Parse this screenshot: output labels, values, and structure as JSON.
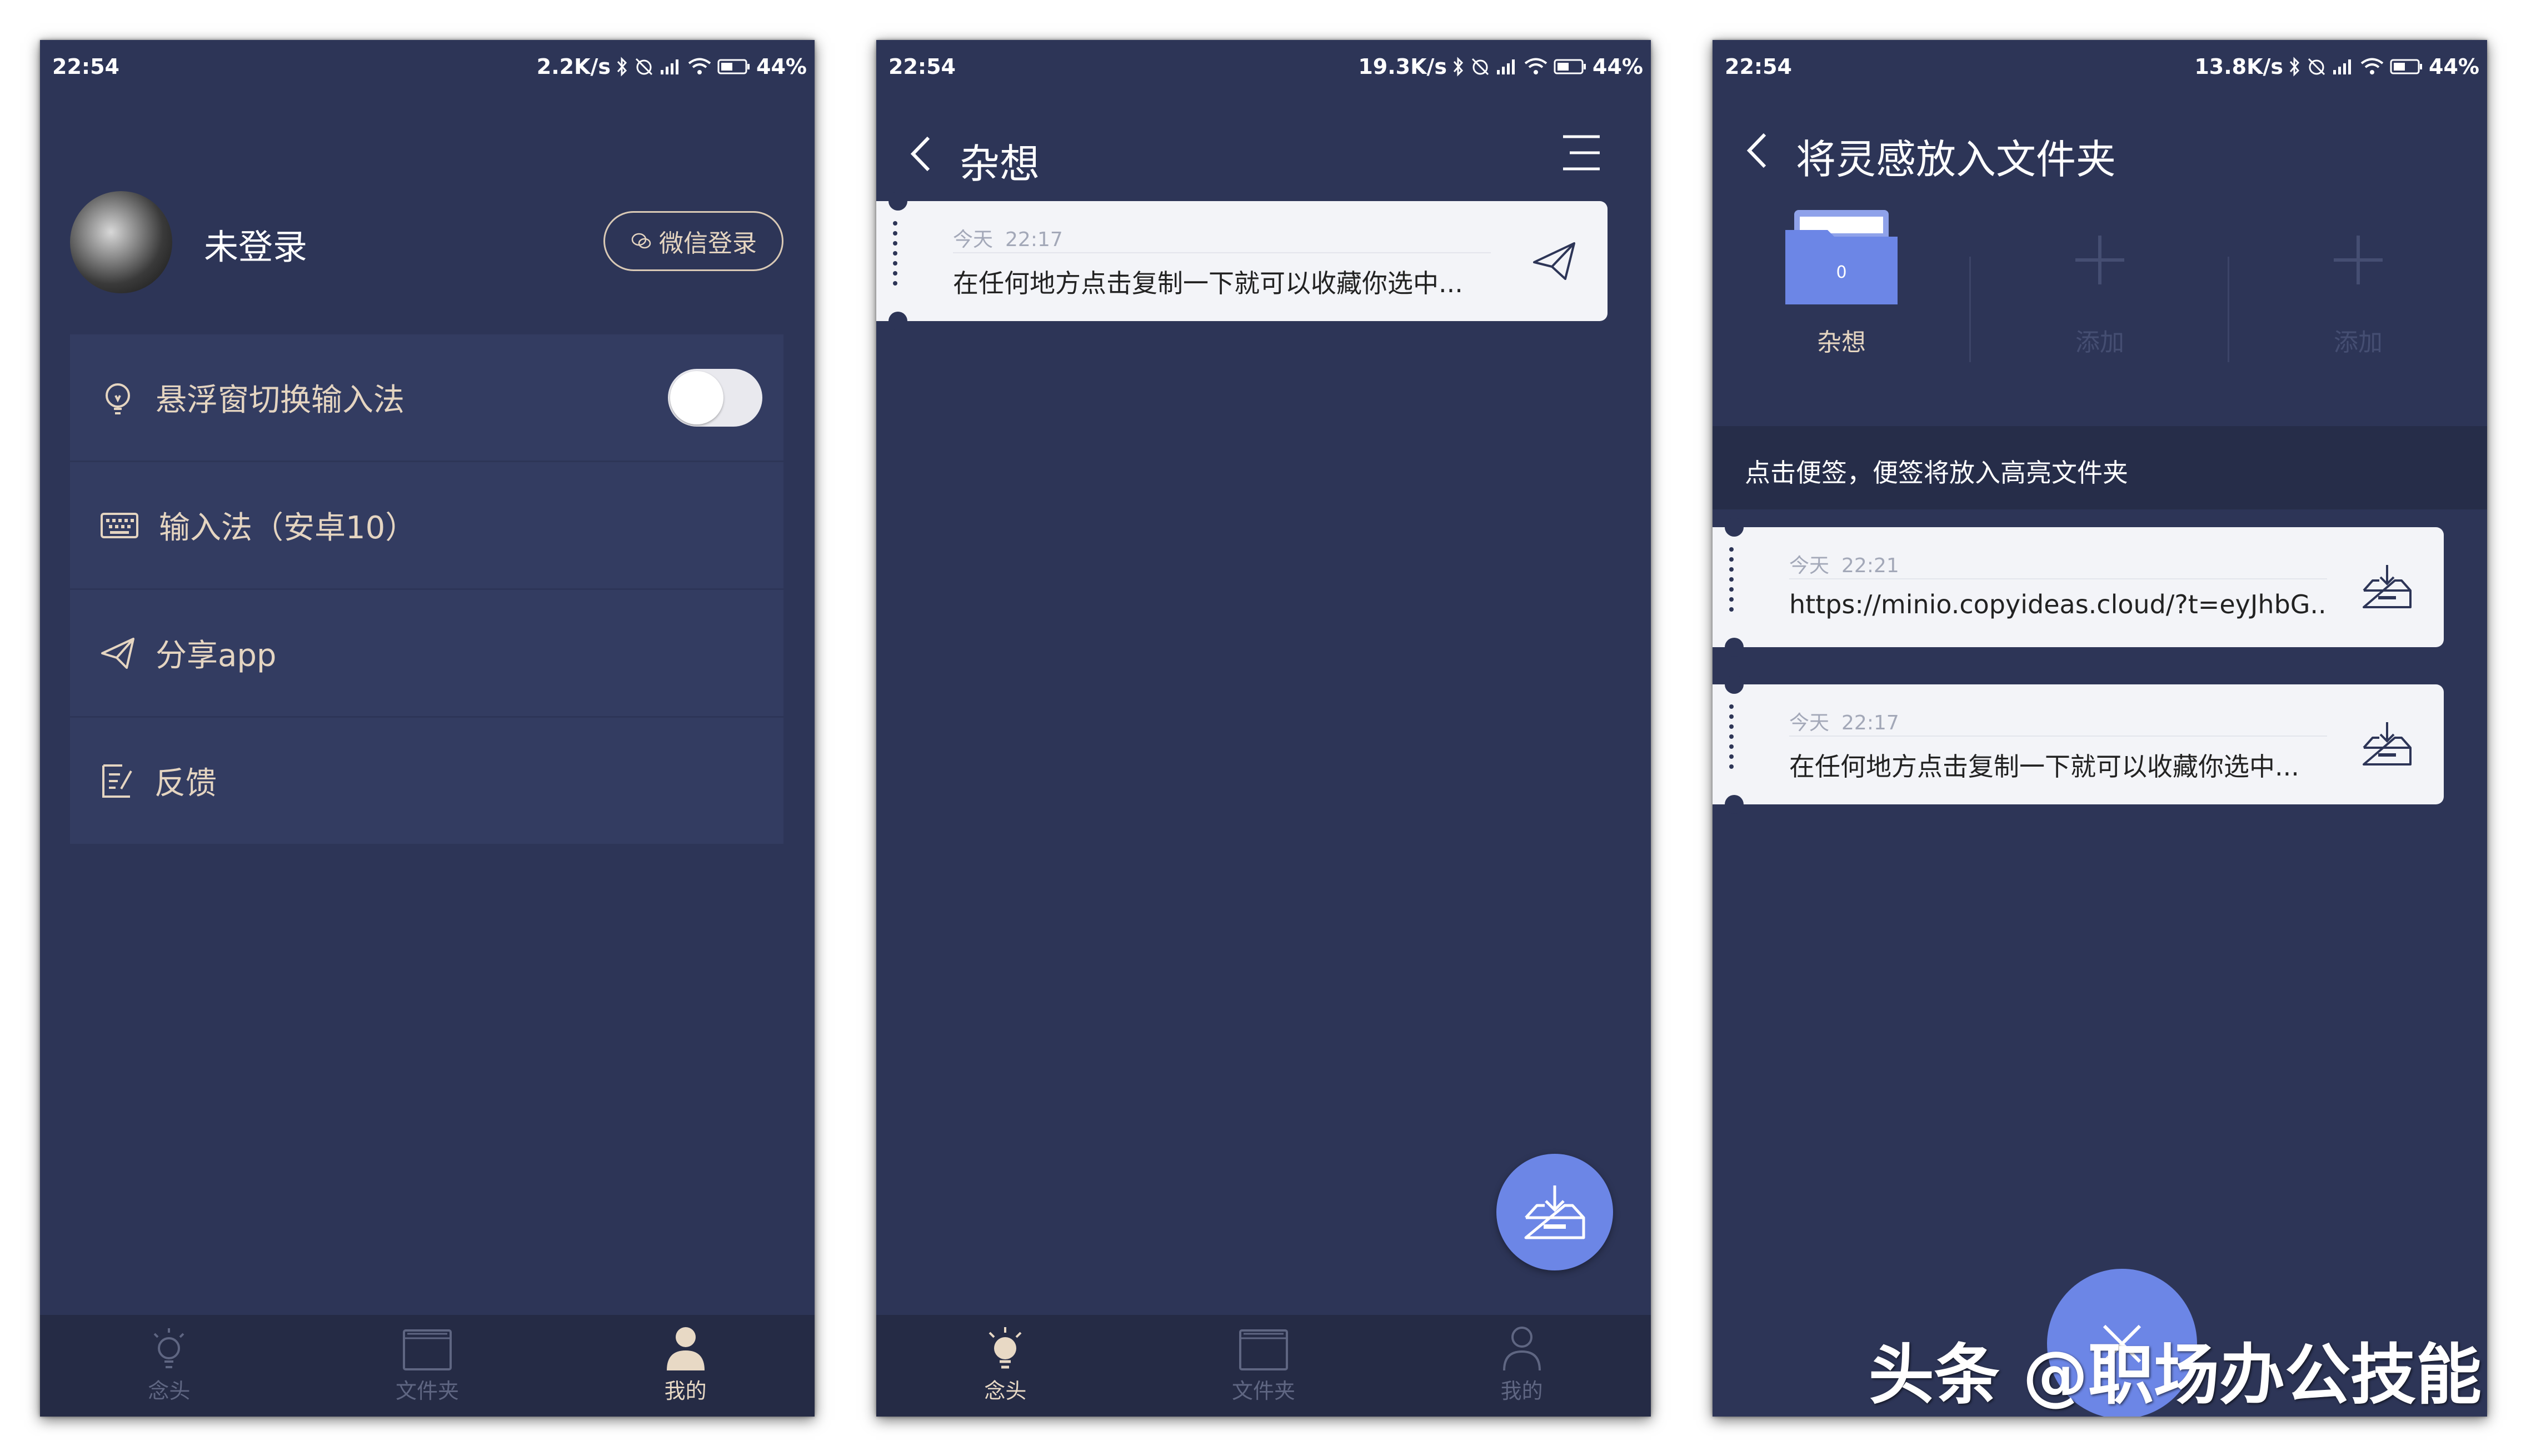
{
  "status_bars": [
    {
      "time": "22:54",
      "speed": "2.2K/s",
      "battery": "44%"
    },
    {
      "time": "22:54",
      "speed": "19.3K/s",
      "battery": "44%"
    },
    {
      "time": "22:54",
      "speed": "13.8K/s",
      "battery": "44%"
    }
  ],
  "nav": {
    "idea": "念头",
    "folder": "文件夹",
    "mine": "我的"
  },
  "profile": {
    "username": "未登录",
    "wechat_login": "微信登录"
  },
  "settings_menu": [
    {
      "label": "悬浮窗切换输入法",
      "icon": "bulb-outline-icon"
    },
    {
      "label": "输入法（安卓10）",
      "icon": "keyboard-icon"
    },
    {
      "label": "分享app",
      "icon": "send-icon"
    },
    {
      "label": "反馈",
      "icon": "feedback-icon"
    }
  ],
  "colors": {
    "background": "#2d3557",
    "accent": "#6c86e6",
    "gold_text": "#e5d5c1",
    "card": "#f3f4f8"
  },
  "notes_screen": {
    "title": "杂想",
    "notes": [
      {
        "day": "今天",
        "time": "22:17",
        "text": "在任何地方点击复制一下就可以收藏你选中..."
      }
    ]
  },
  "folder_screen": {
    "title": "将灵感放入文件夹",
    "folders": [
      {
        "name": "杂想",
        "count": "0"
      },
      {
        "name": "添加"
      },
      {
        "name": "添加"
      }
    ],
    "hint": "点击便签，便签将放入高亮文件夹",
    "notes": [
      {
        "day": "今天",
        "time": "22:21",
        "text": "https://minio.copyideas.cloud/?t=eyJhbG..."
      },
      {
        "day": "今天",
        "time": "22:17",
        "text": "在任何地方点击复制一下就可以收藏你选中..."
      }
    ]
  },
  "watermark": "头条 @职场办公技能"
}
